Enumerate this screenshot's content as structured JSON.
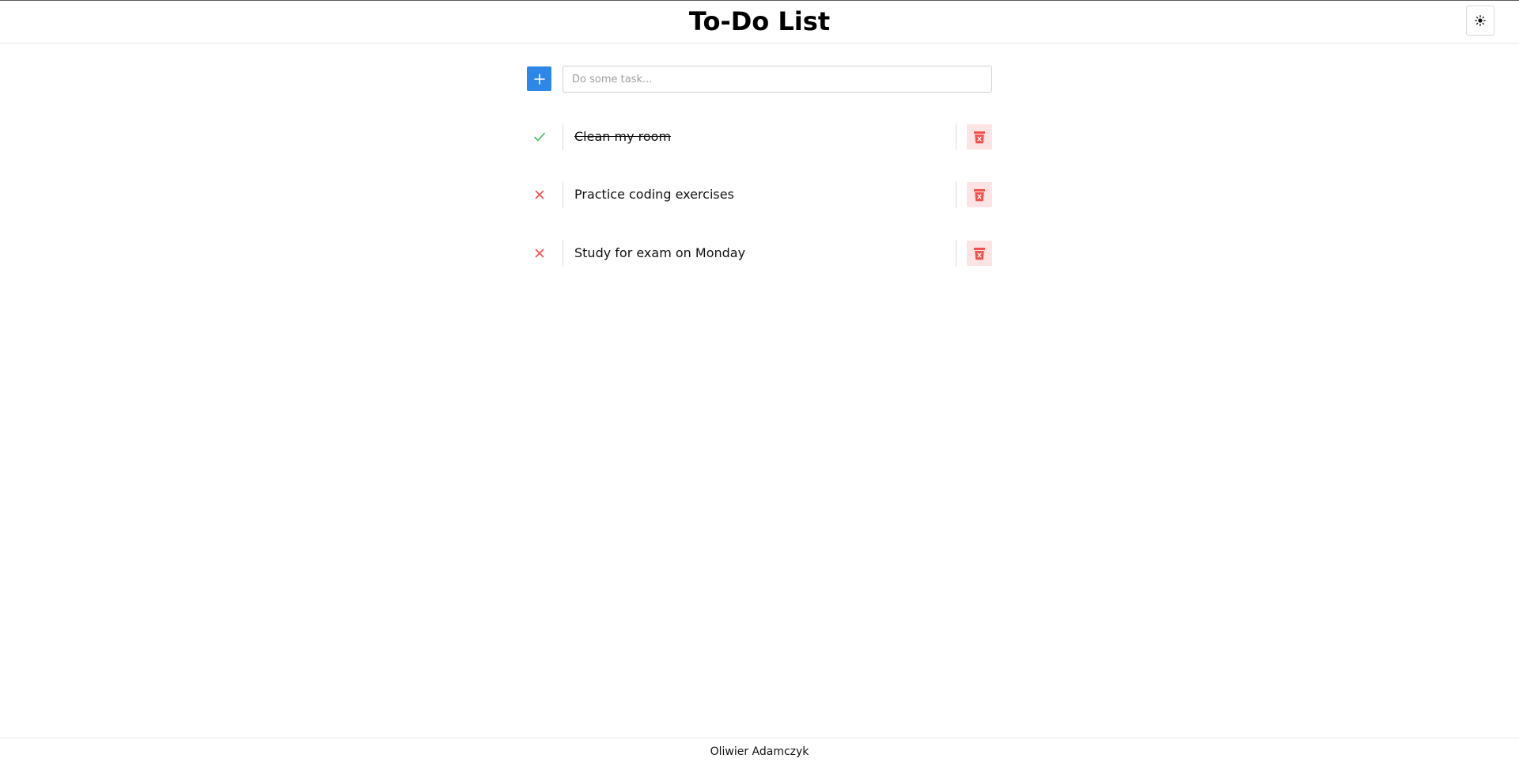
{
  "header": {
    "title": "To-Do List",
    "theme_toggle_icon": "sun-icon"
  },
  "add_task": {
    "button_icon": "plus-icon",
    "input_value": "",
    "input_placeholder": "Do some task..."
  },
  "tasks": [
    {
      "text": "Clean my room",
      "completed": true,
      "status_icon": "check-icon",
      "delete_icon": "trash-icon"
    },
    {
      "text": "Practice coding exercises",
      "completed": false,
      "status_icon": "x-icon",
      "delete_icon": "trash-icon"
    },
    {
      "text": "Study for exam on Monday",
      "completed": false,
      "status_icon": "x-icon",
      "delete_icon": "trash-icon"
    }
  ],
  "footer": {
    "author": "Oliwier Adamczyk"
  },
  "colors": {
    "accent": "#2e86e6",
    "done": "#3dbb5a",
    "undone": "#e94f4f",
    "delete_bg": "#fde4e4",
    "delete_icon": "#ef5350"
  }
}
